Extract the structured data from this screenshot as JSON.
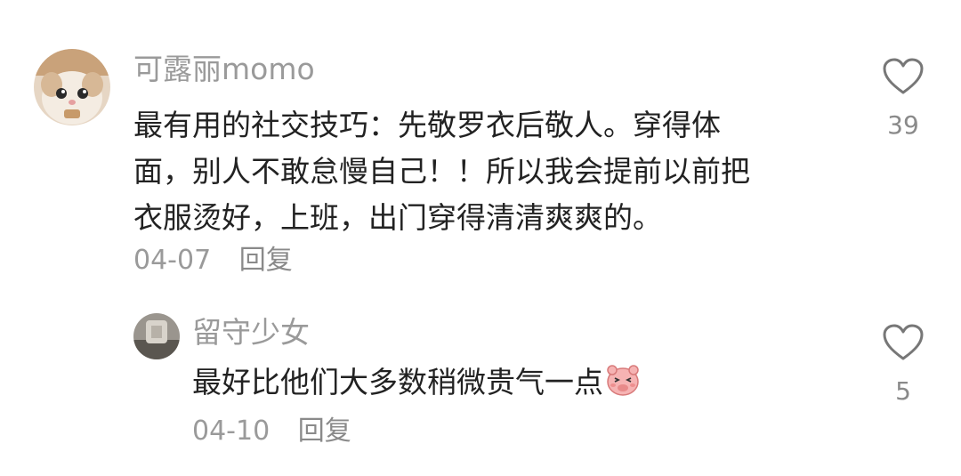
{
  "comments": [
    {
      "username": "可露丽momo",
      "avatar": "cat-photo",
      "text_lines": [
        "最有用的社交技巧：先敬罗衣后敬人。穿得体",
        "面，别人不敢怠慢自己！！所以我会提前以前把",
        "衣服烫好，上班，出门穿得清清爽爽的。"
      ],
      "date": "04-07",
      "reply_label": "回复",
      "likes": "39",
      "like_icon": "heart-outline-icon"
    },
    {
      "username": "留守少女",
      "avatar": "photo",
      "text": "最好比他们大多数稍微贵气一点",
      "emoji": "blushing-pig-face-emoji",
      "date": "04-10",
      "reply_label": "回复",
      "likes": "5",
      "like_icon": "heart-outline-icon"
    }
  ],
  "colors": {
    "text": "#222222",
    "meta": "#9a9a9a",
    "icon": "#777777",
    "background": "#ffffff"
  }
}
